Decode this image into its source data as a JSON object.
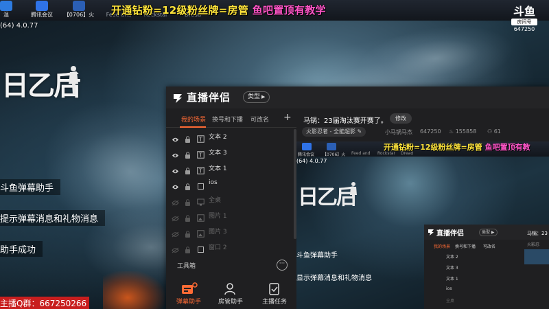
{
  "taskbar": {
    "apps": [
      {
        "label": "温",
        "color": "#2d7be0"
      },
      {
        "label": "腾讯会议",
        "color": "#2f73e8"
      },
      {
        "label": "【0706】火",
        "color": "#2b5fb5"
      },
      {
        "label": "Feed and",
        "color": "#555b63"
      },
      {
        "label": "Rockstar",
        "color": "#e3a21a"
      },
      {
        "label": "Dread",
        "color": "#4a4f56"
      }
    ],
    "version": "(64) 4.0.77"
  },
  "banner": {
    "part1": "开通钻粉=12级粉丝牌=房管",
    "part2": "鱼吧置顶有教学"
  },
  "douyu_badge": {
    "logo": "斗鱼",
    "room_label": "房间号",
    "room_number": "647250"
  },
  "game_logo": "日乙后",
  "overlay": {
    "lines": [
      "斗鱼弹幕助手",
      "提示弹幕消息和礼物消息",
      "助手成功"
    ],
    "qq_group": "主播Q群：667250266"
  },
  "panel": {
    "title": "直播伴侣",
    "type_button": "类型",
    "tabs": [
      "我的场景",
      "换号和下播",
      "可改名"
    ],
    "add_symbol": "+",
    "scenes": [
      {
        "label": "文本 2",
        "type": "text-icon",
        "disabled": false
      },
      {
        "label": "文本 3",
        "type": "text-icon",
        "disabled": false
      },
      {
        "label": "文本 1",
        "type": "text-icon",
        "disabled": false
      },
      {
        "label": "ios",
        "type": "window-icon",
        "disabled": false
      },
      {
        "label": "全桌",
        "type": "monitor-icon",
        "disabled": true
      },
      {
        "label": "图片 1",
        "type": "image-icon",
        "disabled": true
      },
      {
        "label": "图片 3",
        "type": "image-icon",
        "disabled": true
      },
      {
        "label": "窗口 2",
        "type": "window-icon",
        "disabled": true
      }
    ],
    "tools_label": "工具箱",
    "tools_more": "···",
    "tools": [
      {
        "label": "弹幕助手",
        "active": true
      },
      {
        "label": "房管助手",
        "active": false
      },
      {
        "label": "主播任务",
        "active": false
      }
    ],
    "room_title": "马锅：23届淘汰赛开赛了。",
    "edit_label": "修改",
    "category": "火影忍者 - 全能超影",
    "streamer_name": "小马锅马杰",
    "room_id": "647250",
    "heat": "155858",
    "viewers": "61",
    "accent_color": "#ff6b35"
  },
  "nested": {
    "banner_part1": "开通钻粉=12级粉丝牌=房管",
    "banner_part2": "鱼吧置顶有教",
    "app_labels": [
      "腾讯会议",
      "【0706】火",
      "Feed and",
      "Rockstar",
      "Dread"
    ],
    "version": "(64) 4.0.77",
    "game_logo": "日乙后",
    "overlay_lines": [
      "斗鱼弹幕助手",
      "显示弹幕消息和礼物消息"
    ],
    "mini_panel": {
      "title": "直播伴侣",
      "type_button": "类型",
      "tabs": [
        "我的场景",
        "换号和下播",
        "可改名"
      ],
      "scenes": [
        "文本 2",
        "文本 3",
        "文本 1",
        "ios",
        "全桌"
      ],
      "room_prefix": "马锅：23",
      "category_prefix": "火影忍"
    }
  }
}
